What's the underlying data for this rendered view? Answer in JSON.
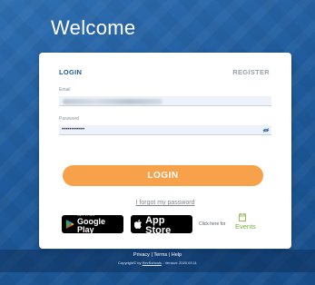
{
  "header": {
    "title": "Welcome"
  },
  "tabs": {
    "login": "LOGIN",
    "register": "REGISTER"
  },
  "form": {
    "email_label": "Email",
    "password_label": "Password",
    "password_value": "••••••••••••",
    "login_button": "LOGIN",
    "forgot_link": "I forgot my password"
  },
  "badges": {
    "google_small": "GET IT ON",
    "google_big": "Google Play",
    "apple_small": "Download on the",
    "apple_big": "App Store"
  },
  "events": {
    "click_text": "Click here for",
    "label": "Events"
  },
  "footer": {
    "links": "Privacy | Terms | Help",
    "copyright_prefix": "Copyright© by",
    "brand": "RevSchools",
    "version": "- Version: 2020.03.11"
  },
  "colors": {
    "background": "#1f5b9c",
    "accent": "#f7a14a",
    "tab_active": "#1f5b9c",
    "events_green": "#7cae3a"
  }
}
